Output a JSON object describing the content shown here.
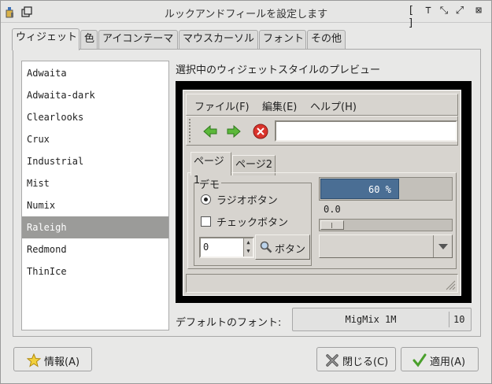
{
  "window": {
    "title": "ルックアンドフィールを設定します",
    "controls": [
      "[ ]",
      "⊤",
      "⤡",
      "⤢",
      "⊠"
    ]
  },
  "tabs": [
    {
      "label": "ウィジェット",
      "active": true
    },
    {
      "label": "色"
    },
    {
      "label": "アイコンテーマ"
    },
    {
      "label": "マウスカーソル"
    },
    {
      "label": "フォント"
    },
    {
      "label": "その他"
    }
  ],
  "themes": {
    "items": [
      "Adwaita",
      "Adwaita-dark",
      "Clearlooks",
      "Crux",
      "Industrial",
      "Mist",
      "Numix",
      "Raleigh",
      "Redmond",
      "ThinIce"
    ],
    "selected_index": 7
  },
  "preview": {
    "label": "選択中のウィジェットスタイルのプレビュー",
    "menu": [
      "ファイル(F)",
      "編集(E)",
      "ヘルプ(H)"
    ],
    "toolbar_icons": [
      "back-arrow-icon",
      "forward-arrow-icon",
      "stop-icon"
    ],
    "tabs": [
      "ページ1",
      "ページ2"
    ],
    "frame_title": "デモ",
    "radio_label": "ラジオボタン",
    "check_label": "チェックボタン",
    "spin_value": "0",
    "button_label": "ボタン",
    "progress_text": "60 %",
    "progress_fraction": 0.6,
    "scale_value": "0.0",
    "scale_fraction": 0.0
  },
  "font": {
    "label": "デフォルトのフォント:",
    "name": "MigMix 1M",
    "size": "10"
  },
  "buttons": {
    "about": "情報(A)",
    "close": "閉じる(C)",
    "apply": "適用(A)"
  },
  "colors": {
    "selection": "#9b9b99",
    "progress": "#4a6e94",
    "arrow_green": "#5cb83a",
    "stop_red": "#d9332b"
  }
}
